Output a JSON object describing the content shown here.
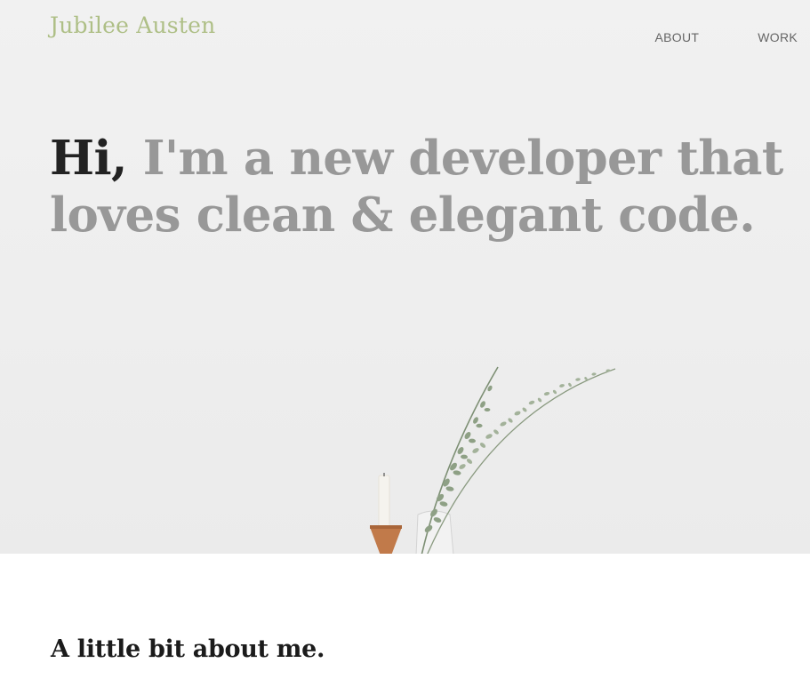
{
  "header": {
    "brand": "Jubilee Austen",
    "nav": [
      {
        "label": "ABOUT"
      },
      {
        "label": "WORK"
      }
    ]
  },
  "hero": {
    "greeting": "Hi,",
    "line1_rest": " I'm a new developer that",
    "line2": "loves clean & elegant code."
  },
  "about": {
    "heading": "A little bit about me."
  },
  "colors": {
    "brand": "#aebf86",
    "headline_muted": "#989898",
    "headline_dark": "#222222",
    "nav_text": "#666666",
    "hero_bg": "#eeeeee"
  },
  "icons": {
    "decoration": "eucalyptus-vase-candle-illustration"
  }
}
